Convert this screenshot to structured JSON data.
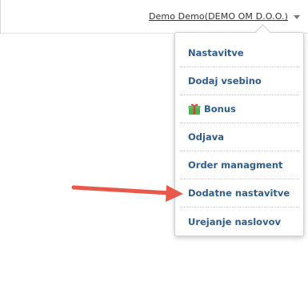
{
  "header": {
    "user_label": "Demo Demo(DEMO OM D.O.O.)"
  },
  "menu": {
    "items": [
      {
        "label": "Nastavitve"
      },
      {
        "label": "Dodaj vsebino"
      },
      {
        "label": "Bonus",
        "icon": "gift-icon"
      },
      {
        "label": "Odjava"
      },
      {
        "label": "Order managment"
      },
      {
        "label": "Dodatne nastavitve"
      },
      {
        "label": "Urejanje naslovov"
      }
    ]
  },
  "colors": {
    "menu_text": "#2f5e8c",
    "annotation_arrow": "#e8584b",
    "gift_green": "#4caf50",
    "gift_red": "#e53935"
  }
}
